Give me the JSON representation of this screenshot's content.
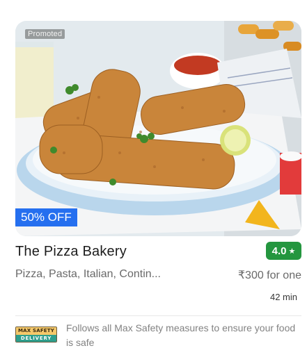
{
  "card": {
    "promoted_label": "Promoted",
    "offer_label": "50% OFF",
    "restaurant_name": "The Pizza Bakery",
    "rating": "4.0",
    "rating_icon": "star-icon",
    "cuisines": "Pizza, Pasta, Italian, Contin...",
    "price": "₹300 for one",
    "delivery_time": "42 min",
    "safety_badge": {
      "line1": "MAX SAFETY",
      "line2": "DELIVERY"
    },
    "safety_text": "Follows all Max Safety measures to ensure your food is safe"
  },
  "colors": {
    "offer_blue": "#256fef",
    "rating_green": "#24963f",
    "text_dark": "#1c1c1c",
    "text_grey": "#696969"
  }
}
